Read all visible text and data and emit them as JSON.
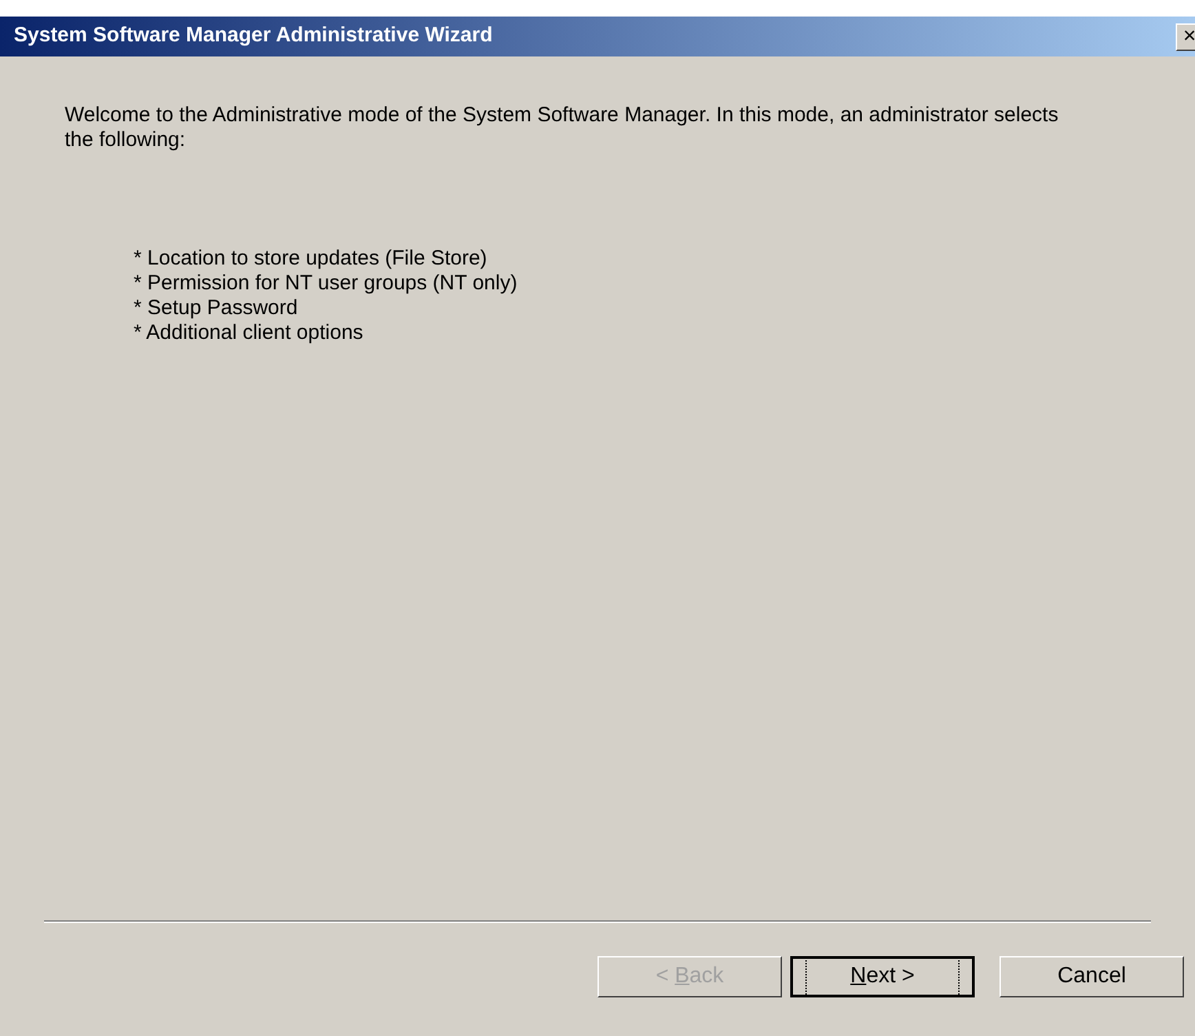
{
  "window": {
    "title": "System Software Manager Administrative Wizard",
    "close_glyph": "×"
  },
  "intro": "Welcome to the Administrative mode of the System Software Manager.  In this mode, an administrator selects the following:",
  "items": [
    "* Location to store updates (File Store)",
    "* Permission for NT user groups (NT only)",
    "* Setup Password",
    "* Additional client options"
  ],
  "buttons": [
    {
      "kind": "back",
      "disabled": true,
      "default": false,
      "parts": [
        {
          "text": "< ",
          "underline": false
        },
        {
          "text": "B",
          "underline": true
        },
        {
          "text": "ack",
          "underline": false
        }
      ]
    },
    {
      "kind": "next",
      "disabled": false,
      "default": true,
      "parts": [
        {
          "text": "N",
          "underline": true
        },
        {
          "text": "ext >",
          "underline": false
        }
      ]
    },
    {
      "kind": "cancel",
      "disabled": false,
      "default": false,
      "parts": [
        {
          "text": "Cancel",
          "underline": false
        }
      ]
    }
  ]
}
